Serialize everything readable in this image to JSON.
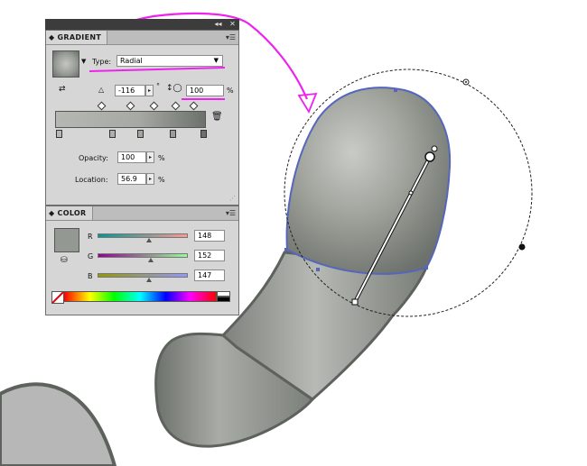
{
  "gradient_panel": {
    "tab_label": "GRADIENT",
    "type_label": "Type:",
    "type_value": "Radial",
    "angle_value": "-116",
    "angle_unit": "°",
    "aspect_value": "100",
    "aspect_unit": "%",
    "opacity_label": "Opacity:",
    "opacity_value": "100",
    "opacity_unit": "%",
    "location_label": "Location:",
    "location_value": "56.9",
    "location_unit": "%"
  },
  "color_panel": {
    "tab_label": "COLOR",
    "r_label": "R",
    "r_value": "148",
    "g_label": "G",
    "g_value": "152",
    "b_label": "B",
    "b_value": "147",
    "swatch_color": "#949893"
  },
  "colors": {
    "annotation": "#ee22ee",
    "selection": "#5566bb",
    "shape_fill": "#8f938e",
    "outline": "#5e625d"
  }
}
